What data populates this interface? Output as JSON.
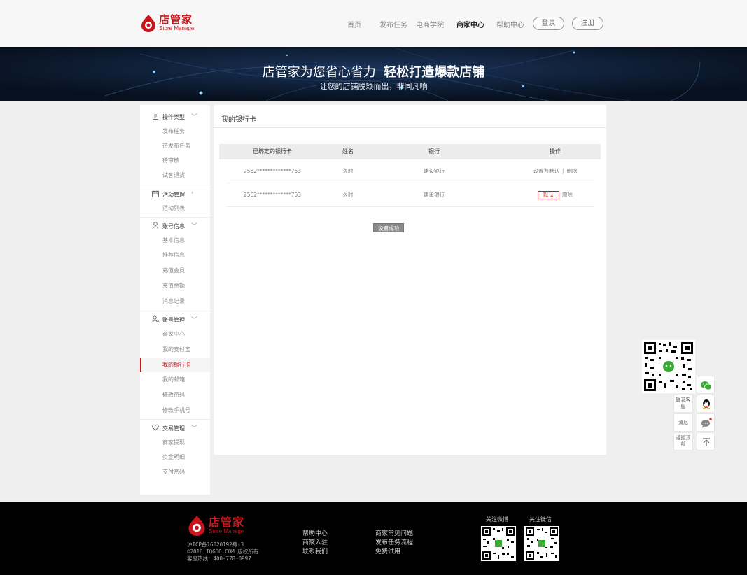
{
  "header": {
    "logo_cn": "店管家",
    "logo_en": "Store Manage",
    "nav": [
      "首页",
      "发布任务",
      "电商学院",
      "商家中心",
      "帮助中心"
    ],
    "login": "登录",
    "register": "注册"
  },
  "banner": {
    "title_normal": "店管家为您省心省力",
    "title_bold": "轻松打造爆款店铺",
    "subtitle": "让您的店铺脱颖而出，非同凡响"
  },
  "sidebar": {
    "sections": [
      {
        "title": "操作类型",
        "icon": "document-icon",
        "items": [
          "发布任务",
          "待发布任务",
          "待审核",
          "试客退货"
        ]
      },
      {
        "title": "活动管理",
        "icon": "calendar-icon",
        "items": [
          "活动列表"
        ]
      },
      {
        "title": "账号信息",
        "icon": "user-icon",
        "items": [
          "基本信息",
          "推荐信息",
          "充值会员",
          "充值余额",
          "消息记录"
        ]
      },
      {
        "title": "账号管理",
        "icon": "user-settings-icon",
        "items": [
          "商家中心",
          "我的支付宝",
          "我的银行卡",
          "我的邮箱",
          "修改密码",
          "修改手机号"
        ]
      },
      {
        "title": "交易管理",
        "icon": "heart-icon",
        "items": [
          "商家提现",
          "资金明细",
          "支付密码"
        ]
      }
    ],
    "active_item": "我的银行卡"
  },
  "main": {
    "title": "我的银行卡",
    "columns": [
      "已绑定的银行卡",
      "姓名",
      "银行",
      "操作"
    ],
    "rows": [
      {
        "card": "2562*************753",
        "name": "久时",
        "bank": "建设银行",
        "op_primary": "设置为默认",
        "op_sep": "|",
        "op_delete": "删除"
      },
      {
        "card": "2562*************753",
        "name": "久时",
        "bank": "建设银行",
        "op_primary": "默认",
        "op_delete": "删除"
      }
    ],
    "toast": "设置成功"
  },
  "float_bar": {
    "contact": "联系客服",
    "message": "消息",
    "back_top": "返回顶部"
  },
  "footer": {
    "logo_cn": "店管家",
    "logo_en": "Store Manage",
    "icp": "沪ICP备16020192号-3",
    "copyright": "©2016 IQGOO.COM 版权所有",
    "hotline": "客服热线：400-778-0997",
    "links_col1": [
      "帮助中心",
      "商家入驻",
      "联系我们"
    ],
    "links_col2": [
      "商家常见问题",
      "发布任务流程",
      "免费试用"
    ],
    "qr_weibo": "关注微博",
    "qr_wechat": "关注微信"
  },
  "colors": {
    "brand": "#c8161d",
    "banner_bg": "#0b1526",
    "footer_bg": "#000000"
  }
}
